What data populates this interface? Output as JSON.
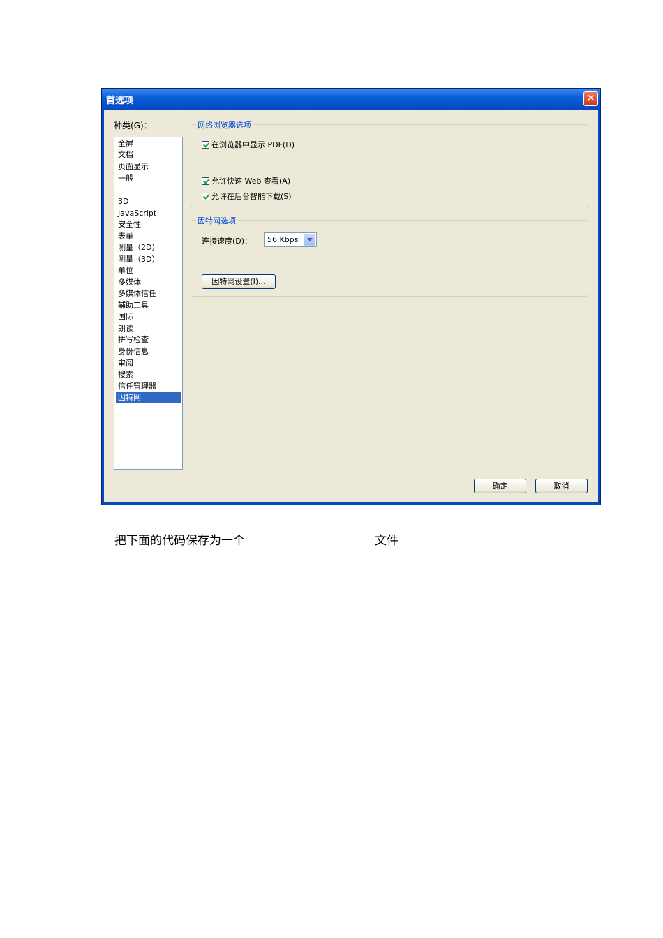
{
  "dialog": {
    "title": "首选项",
    "close_symbol": "✕",
    "category_label": "种类(G)：",
    "categories_top": [
      "全屏",
      "文档",
      "页面显示",
      "一般"
    ],
    "categories_bottom": [
      "3D",
      "JavaScript",
      "安全性",
      "表单",
      "测量（2D）",
      "测量（3D）",
      "单位",
      "多媒体",
      "多媒体信任",
      "辅助工具",
      "国际",
      "朗读",
      "拼写检查",
      "身份信息",
      "审阅",
      "搜索",
      "信任管理器",
      "因特网"
    ],
    "selected_category": "因特网",
    "browser_group": {
      "title": "网络浏览器选项",
      "option1": "在浏览器中显示 PDF(D)",
      "option2": "允许快速 Web 查看(A)",
      "option3": "允许在后台智能下载(S)"
    },
    "internet_group": {
      "title": "因特网选项",
      "speed_label": "连接速度(D)：",
      "speed_value": "56 Kbps",
      "settings_button": "因特网设置(I)..."
    },
    "ok_button": "确定",
    "cancel_button": "取消"
  },
  "caption": {
    "part1": "把下面的代码保存为一个",
    "part2": "文件"
  }
}
